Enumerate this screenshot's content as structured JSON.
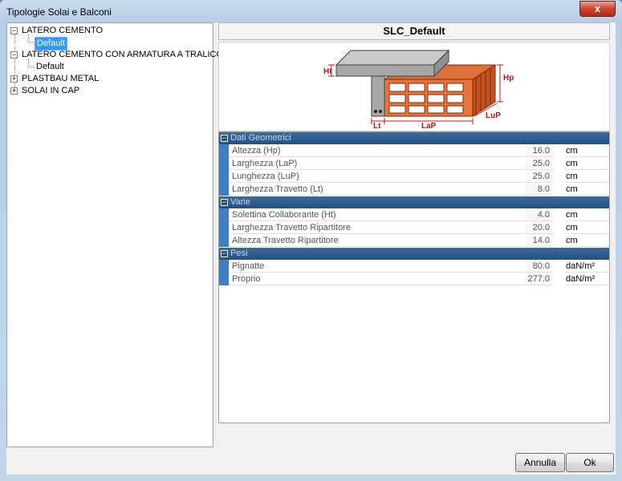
{
  "window": {
    "title": "Tipologie Solai e Balconi",
    "close_glyph": "x"
  },
  "tree": [
    {
      "label": "LATERO CEMENTO",
      "expander": "−"
    },
    {
      "label": "Default",
      "selected": true
    },
    {
      "label": "LATERO CEMENTO CON ARMATURA A TRALICCIO",
      "expander": "−"
    },
    {
      "label": "Default"
    },
    {
      "label": "PLASTBAU METAL",
      "expander": "+"
    },
    {
      "label": "SOLAI IN CAP",
      "expander": "+"
    }
  ],
  "header": {
    "title": "SLC_Default"
  },
  "diagram": {
    "labels": {
      "ht": "Ht",
      "hp": "Hp",
      "lup": "LuP",
      "lap": "LaP",
      "lt": "Lt"
    }
  },
  "grid": {
    "categories": [
      {
        "name": "Dati Geometrici",
        "toggle": "−",
        "rows": [
          {
            "name": "Altezza (Hp)",
            "value": "16.0",
            "unit": "cm"
          },
          {
            "name": "Larghezza (LaP)",
            "value": "25.0",
            "unit": "cm"
          },
          {
            "name": "Lunghezza (LuP)",
            "value": "25.0",
            "unit": "cm"
          },
          {
            "name": "Larghezza Travetto (Lt)",
            "value": "8.0",
            "unit": "cm"
          }
        ]
      },
      {
        "name": "Varie",
        "toggle": "−",
        "rows": [
          {
            "name": "Solettina Collaborante (Ht)",
            "value": "4.0",
            "unit": "cm"
          },
          {
            "name": "Larghezza Travetto Ripartitore",
            "value": "20.0",
            "unit": "cm"
          },
          {
            "name": "Altezza Travetto Ripartitore",
            "value": "14.0",
            "unit": "cm"
          }
        ]
      },
      {
        "name": "Pesi",
        "toggle": "−",
        "rows": [
          {
            "name": "Pignatte",
            "value": "80.0",
            "unit": "daN/m²"
          },
          {
            "name": "Proprio",
            "value": "277.0",
            "unit": "daN/m²"
          }
        ]
      }
    ]
  },
  "buttons": {
    "cancel": "Annulla",
    "ok": "Ok"
  }
}
